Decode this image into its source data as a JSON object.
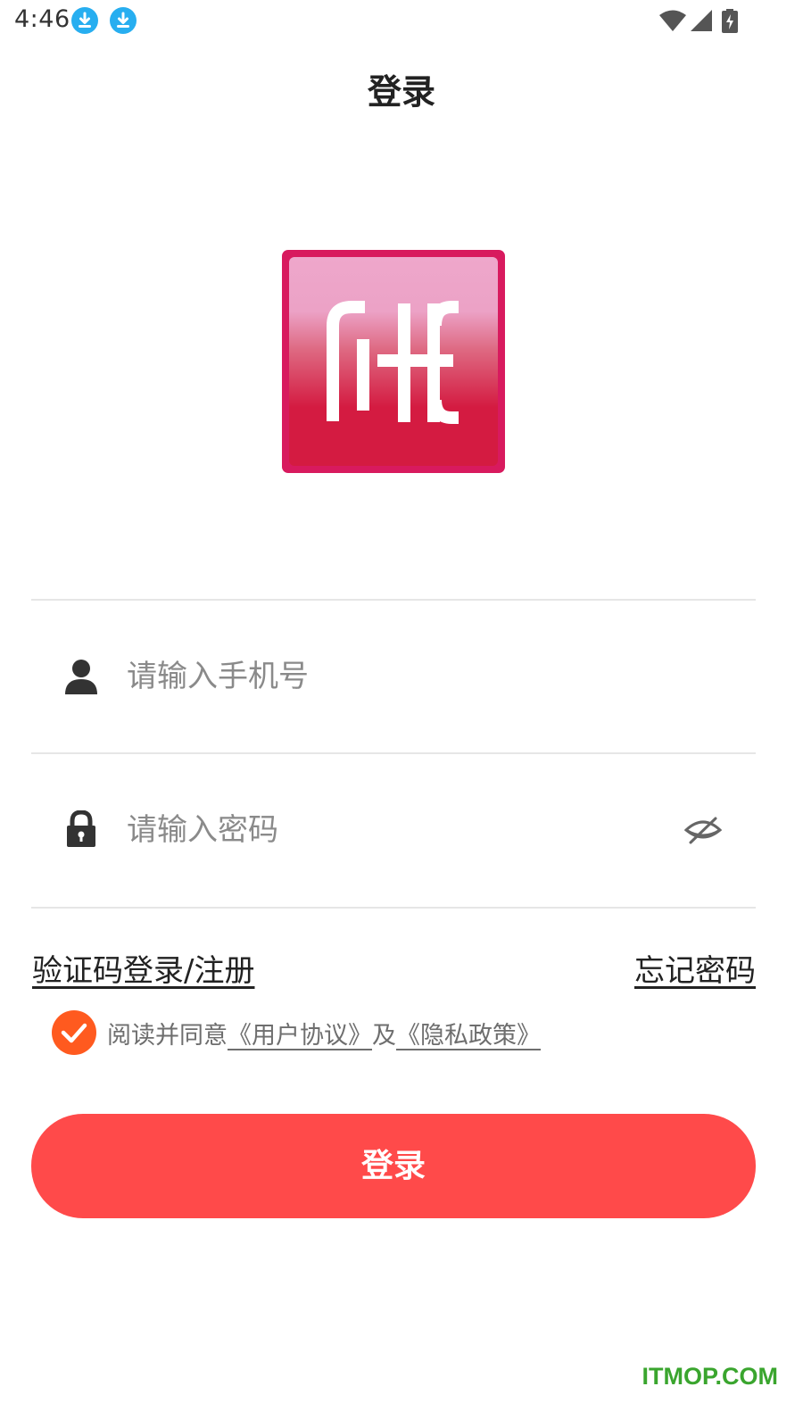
{
  "status_bar": {
    "time": "4:46",
    "notification_icons": [
      "download-icon",
      "download-icon"
    ],
    "right_icons": [
      "wifi-icon",
      "signal-icon",
      "battery-charging-icon"
    ]
  },
  "header": {
    "title": "登录"
  },
  "logo": {
    "icon": "app-logo",
    "colors": {
      "border": "#d81a5e",
      "top": "#eea7cb",
      "bottom": "#d41b41"
    }
  },
  "form": {
    "phone": {
      "placeholder": "请输入手机号",
      "value": "",
      "icon": "user-icon"
    },
    "password": {
      "placeholder": "请输入密码",
      "value": "",
      "icon": "lock-icon",
      "toggle_icon": "eye-off-icon"
    }
  },
  "links": {
    "sms_login": "验证码登录/注册",
    "forgot_password": "忘记密码"
  },
  "agreement": {
    "checked": true,
    "prefix": "阅读并同意",
    "user_agreement": "《用户协议》",
    "and": "及",
    "privacy_policy": "《隐私政策》"
  },
  "login_button": {
    "label": "登录",
    "color": "#ff4a4a"
  },
  "watermark": "ITMOP.COM",
  "colors": {
    "accent": "#ff4a4a",
    "check": "#ff5a1f",
    "watermark": "#3aa52e"
  }
}
